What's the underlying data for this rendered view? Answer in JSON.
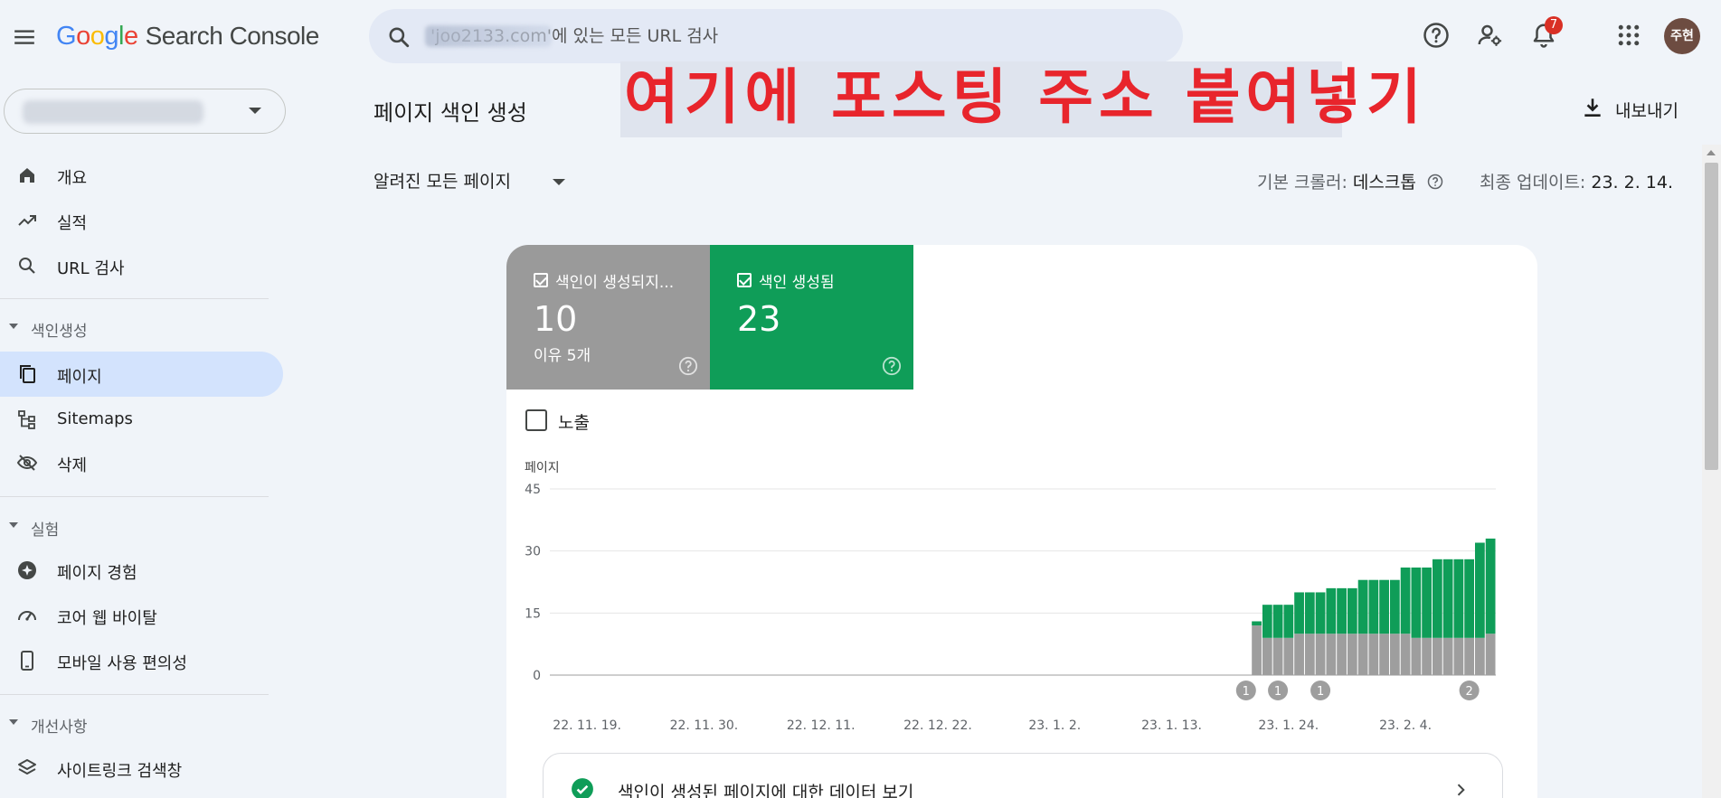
{
  "app": {
    "logo_letters": [
      "G",
      "o",
      "o",
      "g",
      "l",
      "e"
    ],
    "product_name": "Search Console"
  },
  "search": {
    "placeholder": "'joo2133.com'에 있는 모든 URL 검사"
  },
  "toolbar": {
    "help_icon": "help-circle-icon",
    "manage_users_icon": "person-gear-icon",
    "notifications_icon": "bell-icon",
    "notification_count": "7",
    "apps_icon": "grid-icon",
    "avatar_initials": "주현"
  },
  "property": {
    "name": "joo2133.com"
  },
  "sidebar": {
    "items": [
      {
        "label": "개요",
        "icon": "home-icon"
      },
      {
        "label": "실적",
        "icon": "trend-icon"
      },
      {
        "label": "URL 검사",
        "icon": "search-icon"
      }
    ],
    "sections": [
      {
        "title": "색인생성",
        "items": [
          {
            "label": "페이지",
            "icon": "pages-icon",
            "active": true
          },
          {
            "label": "Sitemaps",
            "icon": "sitemap-icon"
          },
          {
            "label": "삭제",
            "icon": "eye-off-icon"
          }
        ]
      },
      {
        "title": "실험",
        "items": [
          {
            "label": "페이지 경험",
            "icon": "star-circle-icon"
          },
          {
            "label": "코어 웹 바이탈",
            "icon": "speed-icon"
          },
          {
            "label": "모바일 사용 편의성",
            "icon": "phone-icon"
          }
        ]
      },
      {
        "title": "개선사항",
        "items": [
          {
            "label": "사이트링크 검색창",
            "icon": "layers-icon"
          }
        ]
      }
    ]
  },
  "header": {
    "page_title": "페이지 색인 생성",
    "overlay_text": "여기에 포스팅 주소 붙여넣기",
    "export_label": "내보내기"
  },
  "filters": {
    "pages_filter": "알려진 모든 페이지",
    "crawler_label": "기본 크롤러:",
    "crawler_value": "데스크톱",
    "updated_label": "최종 업데이트:",
    "updated_value": "23. 2. 14."
  },
  "summary": {
    "not_indexed": {
      "label": "색인이 생성되지...",
      "value": "10",
      "sub": "이유 5개",
      "color": "#9a9a9a"
    },
    "indexed": {
      "label": "색인 생성됨",
      "value": "23",
      "color": "#0f9d58"
    }
  },
  "impressions": {
    "label": "노출",
    "checked": false
  },
  "chart_data": {
    "type": "bar",
    "stacked": true,
    "ylabel": "페이지",
    "ylim": [
      0,
      45
    ],
    "yticks": [
      0,
      15,
      30,
      45
    ],
    "x_tick_labels": [
      "22. 11. 19.",
      "22. 11. 30.",
      "22. 12. 11.",
      "22. 12. 22.",
      "23. 1. 2.",
      "23. 1. 13.",
      "23. 1. 24.",
      "23. 2. 4."
    ],
    "categories": [
      "22. 11. 16.",
      "22. 11. 17.",
      "22. 11. 18.",
      "22. 11. 19.",
      "22. 11. 20.",
      "22. 11. 21.",
      "22. 11. 22.",
      "22. 11. 23.",
      "22. 11. 24.",
      "22. 11. 25.",
      "22. 11. 26.",
      "22. 11. 27.",
      "22. 11. 28.",
      "22. 11. 29.",
      "22. 11. 30.",
      "22. 12. 1.",
      "22. 12. 2.",
      "22. 12. 3.",
      "22. 12. 4.",
      "22. 12. 5.",
      "22. 12. 6.",
      "22. 12. 7.",
      "22. 12. 8.",
      "22. 12. 9.",
      "22. 12. 10.",
      "22. 12. 11.",
      "22. 12. 12.",
      "22. 12. 13.",
      "22. 12. 14.",
      "22. 12. 15.",
      "22. 12. 16.",
      "22. 12. 17.",
      "22. 12. 18.",
      "22. 12. 19.",
      "22. 12. 20.",
      "22. 12. 21.",
      "22. 12. 22.",
      "22. 12. 23.",
      "22. 12. 24.",
      "22. 12. 25.",
      "22. 12. 26.",
      "22. 12. 27.",
      "22. 12. 28.",
      "22. 12. 29.",
      "22. 12. 30.",
      "22. 12. 31.",
      "23. 1. 1.",
      "23. 1. 2.",
      "23. 1. 3.",
      "23. 1. 4.",
      "23. 1. 5.",
      "23. 1. 6.",
      "23. 1. 7.",
      "23. 1. 8.",
      "23. 1. 9.",
      "23. 1. 10.",
      "23. 1. 11.",
      "23. 1. 12.",
      "23. 1. 13.",
      "23. 1. 14.",
      "23. 1. 15.",
      "23. 1. 16.",
      "23. 1. 17.",
      "23. 1. 18.",
      "23. 1. 19.",
      "23. 1. 20.",
      "23. 1. 21.",
      "23. 1. 22.",
      "23. 1. 23.",
      "23. 1. 24.",
      "23. 1. 25.",
      "23. 1. 26.",
      "23. 1. 27.",
      "23. 1. 28.",
      "23. 1. 29.",
      "23. 1. 30.",
      "23. 1. 31.",
      "23. 2. 1.",
      "23. 2. 2.",
      "23. 2. 3.",
      "23. 2. 4.",
      "23. 2. 5.",
      "23. 2. 6.",
      "23. 2. 7.",
      "23. 2. 8.",
      "23. 2. 9.",
      "23. 2. 10.",
      "23. 2. 11.",
      "23. 2. 12."
    ],
    "series": [
      {
        "color": "#9e9e9e",
        "values": [
          0,
          0,
          0,
          0,
          0,
          0,
          0,
          0,
          0,
          0,
          0,
          0,
          0,
          0,
          0,
          0,
          0,
          0,
          0,
          0,
          0,
          0,
          0,
          0,
          0,
          0,
          0,
          0,
          0,
          0,
          0,
          0,
          0,
          0,
          0,
          0,
          0,
          0,
          0,
          0,
          0,
          0,
          0,
          0,
          0,
          0,
          0,
          0,
          0,
          0,
          0,
          0,
          0,
          0,
          0,
          0,
          0,
          0,
          0,
          0,
          0,
          0,
          0,
          0,
          0,
          0,
          12,
          9,
          9,
          9,
          10,
          10,
          10,
          10,
          10,
          10,
          10,
          10,
          10,
          10,
          10,
          9,
          9,
          9,
          9,
          9,
          9,
          9,
          10,
          10,
          10
        ]
      },
      {
        "color": "#0f9d58",
        "values": [
          0,
          0,
          0,
          0,
          0,
          0,
          0,
          0,
          0,
          0,
          0,
          0,
          0,
          0,
          0,
          0,
          0,
          0,
          0,
          0,
          0,
          0,
          0,
          0,
          0,
          0,
          0,
          0,
          0,
          0,
          0,
          0,
          0,
          0,
          0,
          0,
          0,
          0,
          0,
          0,
          0,
          0,
          0,
          0,
          0,
          0,
          0,
          0,
          0,
          0,
          0,
          0,
          0,
          0,
          0,
          0,
          0,
          0,
          0,
          0,
          0,
          0,
          0,
          0,
          0,
          0,
          1,
          8,
          8,
          8,
          10,
          10,
          10,
          11,
          11,
          11,
          13,
          13,
          13,
          13,
          16,
          17,
          17,
          19,
          19,
          19,
          19,
          23,
          23,
          23,
          23
        ]
      }
    ],
    "annotations": [
      {
        "x": "23. 1. 20.",
        "label": "1"
      },
      {
        "x": "23. 1. 23.",
        "label": "1"
      },
      {
        "x": "23. 1. 27.",
        "label": "1"
      },
      {
        "x": "23. 2. 10.",
        "label": "2"
      }
    ],
    "grid": true
  },
  "view_data": {
    "label": "색인이 생성된 페이지에 대한 데이터 보기"
  }
}
